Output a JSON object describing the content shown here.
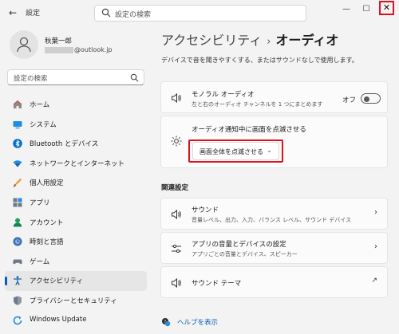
{
  "window": {
    "title": "設定",
    "back_icon": "back-arrow-icon",
    "search_placeholder": "設定の検索",
    "controls": {
      "minimize": "—",
      "maximize": "☐",
      "close": "✕"
    },
    "highlight_color": "#e01020"
  },
  "profile": {
    "name": "秋葉一郎",
    "email_suffix": "@outlook.jp"
  },
  "sidebar": {
    "search_placeholder": "設定の検索",
    "items": [
      {
        "label": "ホーム",
        "icon": "home-icon"
      },
      {
        "label": "システム",
        "icon": "system-icon"
      },
      {
        "label": "Bluetooth とデバイス",
        "icon": "bluetooth-icon"
      },
      {
        "label": "ネットワークとインターネット",
        "icon": "network-icon"
      },
      {
        "label": "個人用設定",
        "icon": "brush-icon"
      },
      {
        "label": "アプリ",
        "icon": "apps-icon"
      },
      {
        "label": "アカウント",
        "icon": "account-icon"
      },
      {
        "label": "時刻と言語",
        "icon": "globe-icon"
      },
      {
        "label": "ゲーム",
        "icon": "game-icon"
      },
      {
        "label": "アクセシビリティ",
        "icon": "accessibility-icon",
        "active": true
      },
      {
        "label": "プライバシーとセキュリティ",
        "icon": "shield-icon"
      },
      {
        "label": "Windows Update",
        "icon": "update-icon"
      }
    ],
    "accent": "#005fb8"
  },
  "main": {
    "breadcrumb_parent": "アクセシビリティ",
    "breadcrumb_sep": "›",
    "breadcrumb_current": "オーディオ",
    "description": "デバイスで音を聞きやすくする、またはサウンドなしで使用します。",
    "mono": {
      "title": "モノラル オーディオ",
      "subtitle": "左と右のオーディオ チャンネルを 1 つにまとめます",
      "toggle_label": "オフ",
      "toggle_on": false
    },
    "flash": {
      "title": "オーディオ通知中に画面を点滅させる",
      "selected": "画面全体を点滅させる",
      "dropdown_chevron": "⌄"
    },
    "related_heading": "関連設定",
    "related": [
      {
        "title": "サウンド",
        "subtitle": "音量レベル、出力、入力、バランス レベル、サウンド デバイス",
        "icon": "speaker-icon",
        "action": "›"
      },
      {
        "title": "アプリの音量とデバイスの設定",
        "subtitle": "アプリごとの音量とデバイス、スピーカー",
        "icon": "mixer-icon",
        "action": "›"
      },
      {
        "title": "サウンド テーマ",
        "subtitle": "",
        "icon": "speaker-icon",
        "action": "↗"
      }
    ],
    "help_link": "ヘルプを表示"
  }
}
